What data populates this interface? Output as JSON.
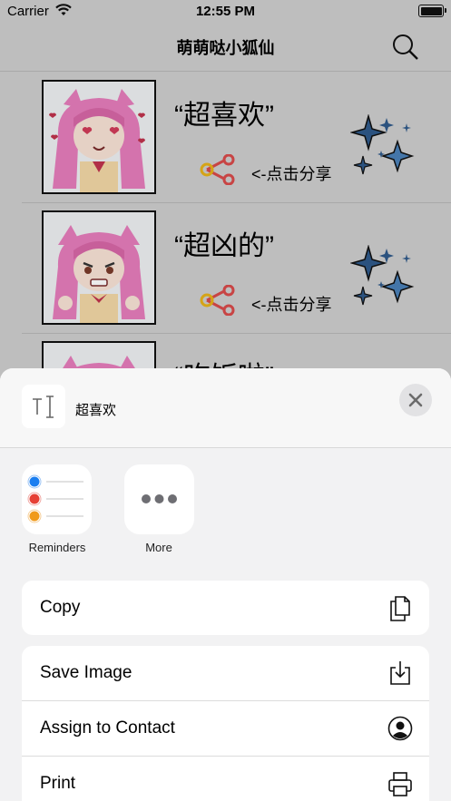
{
  "status_bar": {
    "carrier": "Carrier",
    "time": "12:55 PM"
  },
  "nav": {
    "title": "萌萌哒小狐仙"
  },
  "stickers": [
    {
      "caption": "“超喜欢”",
      "share_label": "<-点击分享"
    },
    {
      "caption": "“超凶的”",
      "share_label": "<-点击分享"
    },
    {
      "caption": "“吃饭啦”"
    }
  ],
  "share_sheet": {
    "preview_text": "超喜欢",
    "apps": [
      {
        "label": "Reminders",
        "icon": "reminders-icon"
      },
      {
        "label": "More",
        "icon": "more-icon"
      }
    ],
    "actions": [
      {
        "label": "Copy",
        "icon": "copy-icon"
      },
      {
        "label": "Save Image",
        "icon": "save-image-icon"
      },
      {
        "label": "Assign to Contact",
        "icon": "contact-icon"
      },
      {
        "label": "Print",
        "icon": "printer-icon"
      }
    ]
  },
  "colors": {
    "share_red": "#d94a4a",
    "share_yellow": "#e8b21a",
    "sparkle_blue": "#2f5a8a",
    "hair_pink": "#e77dbc"
  }
}
